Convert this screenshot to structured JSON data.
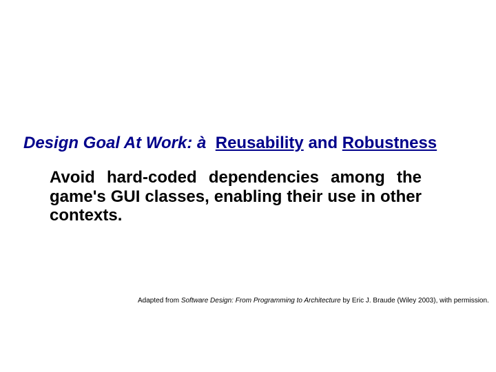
{
  "headline": {
    "prefix": "Design Goal At Work:",
    "arrow": "à",
    "kw1": "Reusability",
    "join": "and",
    "kw2": "Robustness"
  },
  "body": "Avoid hard-coded dependencies among the game's GUI classes, enabling their use in other contexts.",
  "credit": {
    "lead": "Adapted from ",
    "book": "Software Design: From Programming to Architecture",
    "tail": " by Eric J. Braude (Wiley 2003), with permission."
  }
}
